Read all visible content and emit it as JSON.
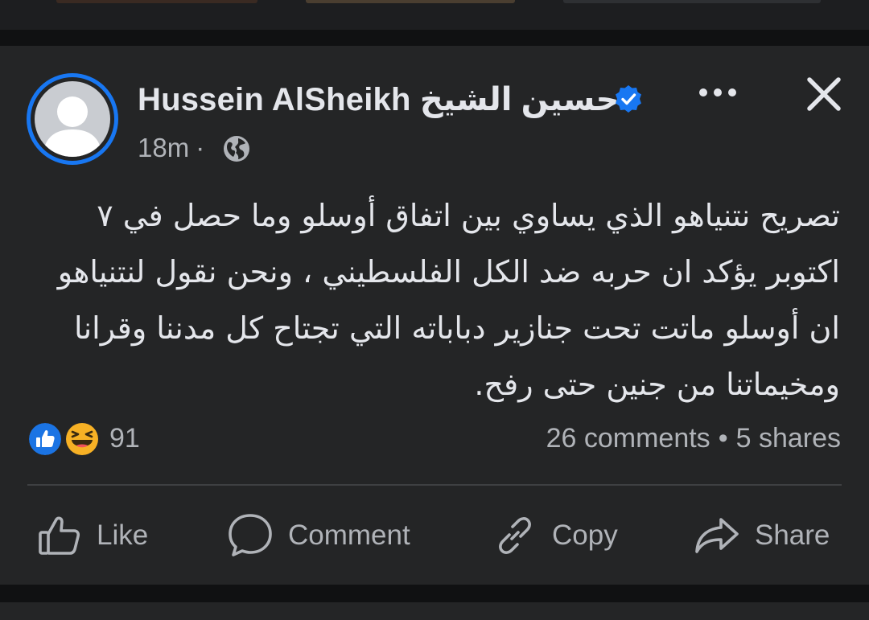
{
  "post": {
    "author": "Hussein AlSheikh حسين الشيخ",
    "time": "18m",
    "separator": "·",
    "body_lines": [
      "تصريح نتنياهو الذي يساوي بين اتفاق أوسلو وما حصل في ٧",
      "اكتوبر يؤكد ان حربه ضد الكل الفلسطيني ، ونحن نقول لنتنياهو",
      "ان أوسلو ماتت تحت جنازير دباباته التي تجتاح كل مدننا وقرانا",
      "ومخيماتنا من جنين حتى رفح."
    ]
  },
  "reactions": {
    "count": "91",
    "types": [
      "like-icon",
      "haha-icon"
    ]
  },
  "stats": {
    "comments": "26 comments",
    "separator": "•",
    "shares": "5 shares"
  },
  "actions": {
    "like": "Like",
    "comment": "Comment",
    "copy": "Copy",
    "share": "Share"
  },
  "colors": {
    "background": "#18191a",
    "card": "#242526",
    "primary_text": "#e4e6eb",
    "secondary_text": "#b0b3b8",
    "accent_blue": "#1877f2",
    "divider": "#3e4042"
  }
}
